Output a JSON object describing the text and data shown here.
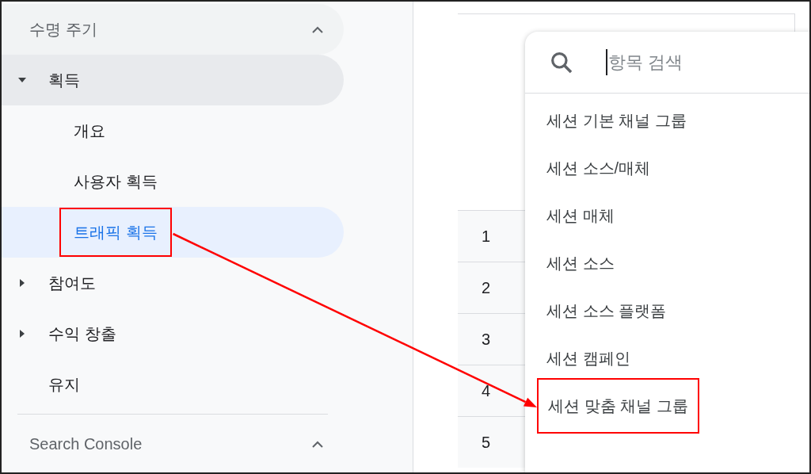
{
  "sidebar": {
    "sections": [
      {
        "title": "수명 주기",
        "expanded": true,
        "items": [
          {
            "label": "획득",
            "kind": "group",
            "expanded": true,
            "selected": false,
            "highlighted": false,
            "children": [
              {
                "label": "개요",
                "selected": false,
                "highlighted": false
              },
              {
                "label": "사용자 획득",
                "selected": false,
                "highlighted": false
              },
              {
                "label": "트래픽 획득",
                "selected": true,
                "highlighted": true
              }
            ]
          },
          {
            "label": "참여도",
            "kind": "group",
            "expanded": false,
            "selected": false,
            "highlighted": false
          },
          {
            "label": "수익 창출",
            "kind": "group",
            "expanded": false,
            "selected": false,
            "highlighted": false
          },
          {
            "label": "유지",
            "kind": "link",
            "selected": false,
            "highlighted": false
          }
        ]
      },
      {
        "title": "Search Console",
        "expanded": true
      }
    ]
  },
  "table": {
    "rows": [
      "1",
      "2",
      "3",
      "4",
      "5"
    ]
  },
  "dimension_menu": {
    "search": {
      "placeholder": "항목 검색"
    },
    "items": [
      {
        "label": "세션 기본 채널 그룹",
        "highlighted": false
      },
      {
        "label": "세션 소스/매체",
        "highlighted": false
      },
      {
        "label": "세션 매체",
        "highlighted": false
      },
      {
        "label": "세션 소스",
        "highlighted": false
      },
      {
        "label": "세션 소스 플랫폼",
        "highlighted": false
      },
      {
        "label": "세션 캠페인",
        "highlighted": false
      },
      {
        "label": "세션 맞춤 채널 그룹",
        "highlighted": true
      }
    ]
  }
}
